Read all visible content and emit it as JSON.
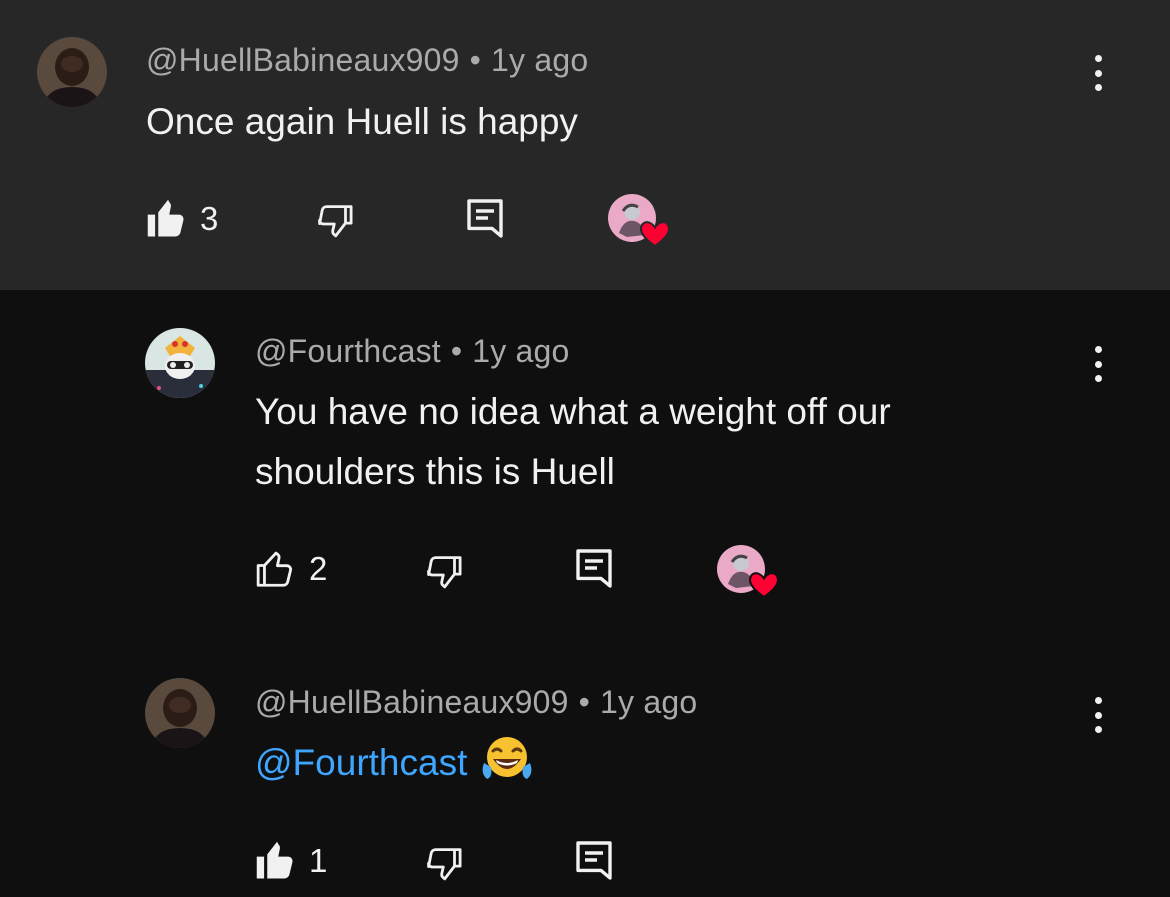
{
  "comments": [
    {
      "author": "@HuellBabineaux909",
      "time": "1y ago",
      "text": "Once again Huell is happy",
      "likes": "3",
      "liked": true,
      "hearted": true
    },
    {
      "author": "@Fourthcast",
      "time": "1y ago",
      "text_line1": "You have no idea what a weight off our",
      "text_line2": "shoulders this is Huell",
      "likes": "2",
      "liked": false,
      "hearted": true
    },
    {
      "author": "@HuellBabineaux909",
      "time": "1y ago",
      "mention": "@Fourthcast",
      "emoji": "face-with-tears-of-joy",
      "likes": "1",
      "liked": true,
      "hearted": false
    }
  ],
  "separator": "•",
  "colors": {
    "top_background": "#272727",
    "page_background": "#0f0f0f",
    "mention": "#3ea6ff",
    "heart": "#ff0033"
  }
}
